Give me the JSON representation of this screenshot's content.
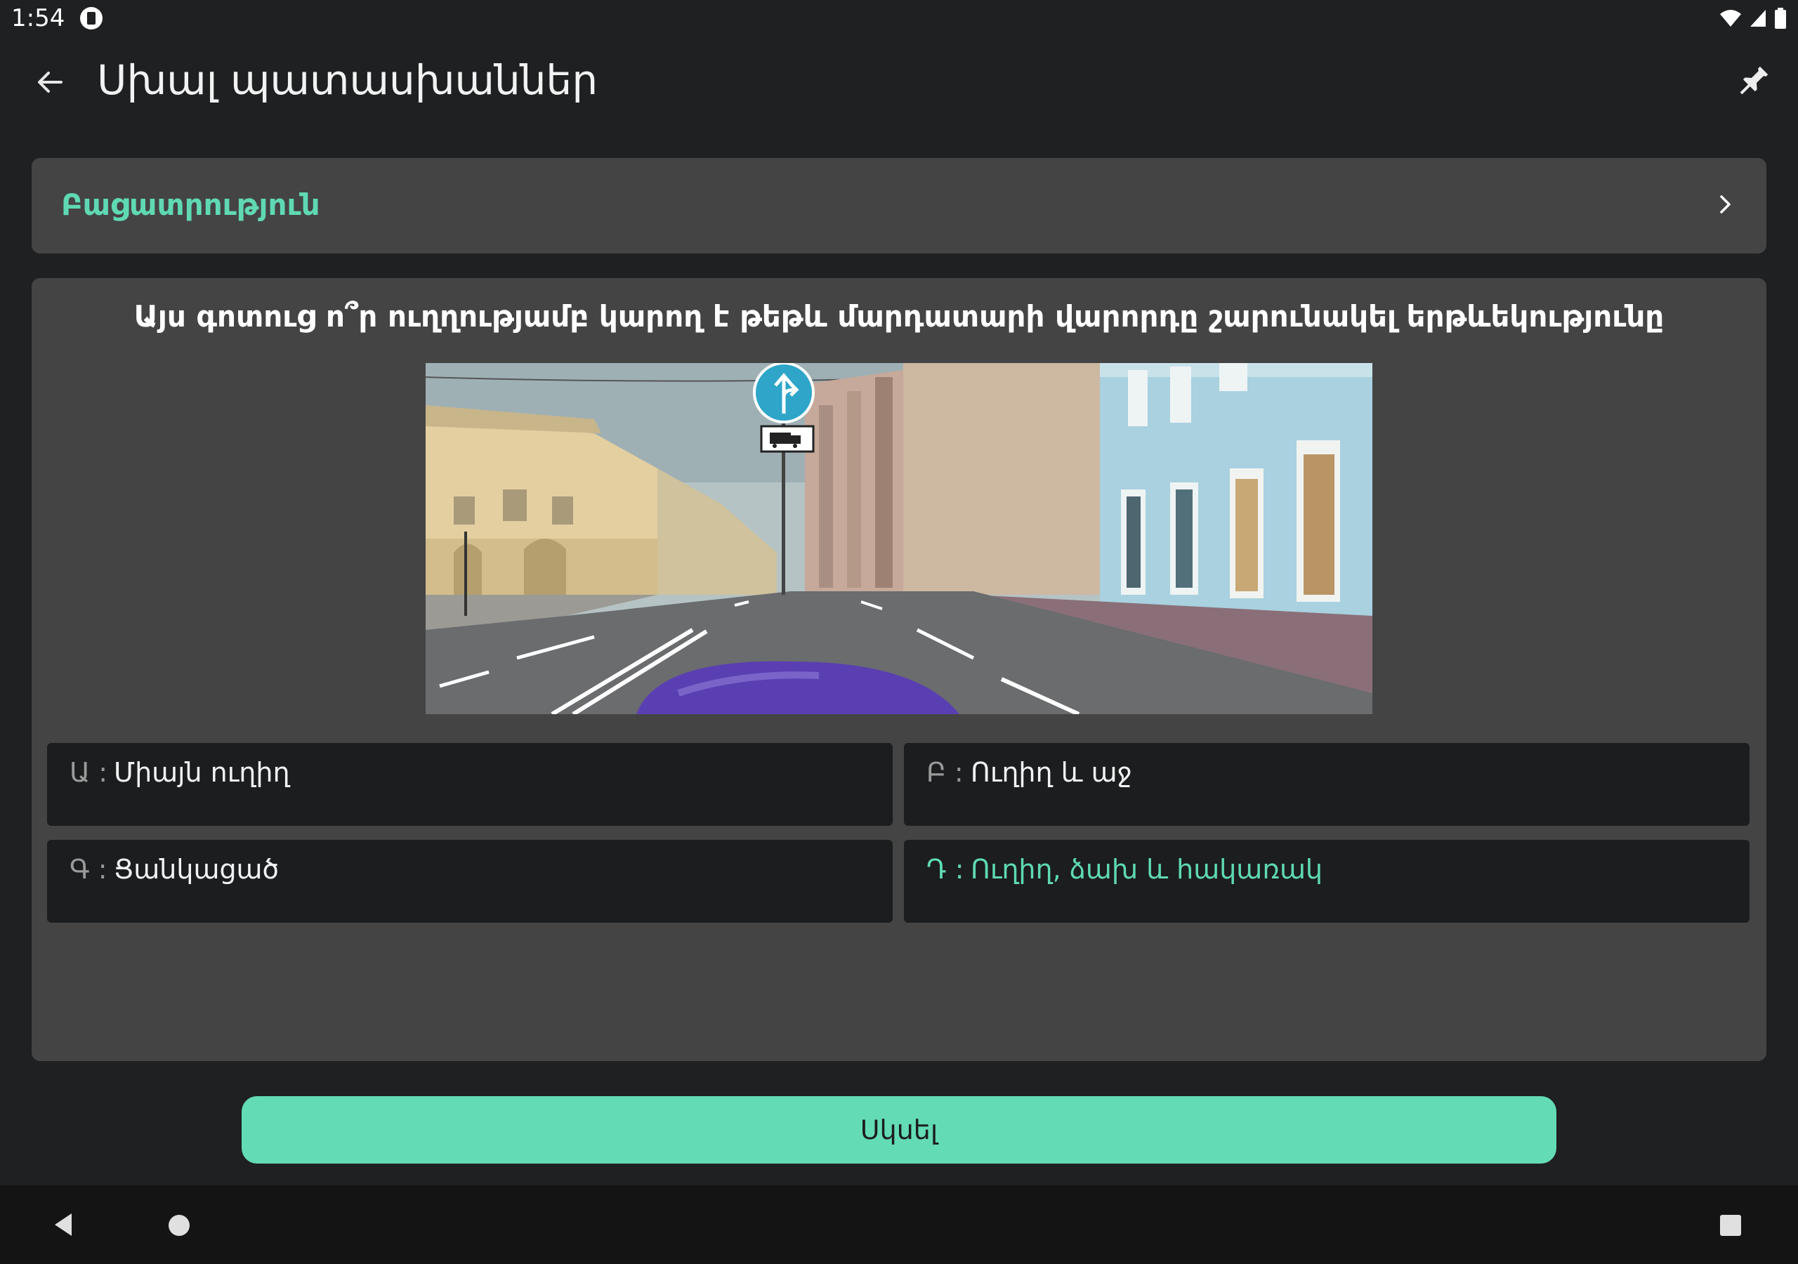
{
  "status_bar": {
    "time": "1:54",
    "icons": [
      "notification-app-icon",
      "wifi-icon",
      "signal-icon",
      "battery-icon"
    ]
  },
  "app_bar": {
    "title": "Սխալ պատասխաններ",
    "back_icon": "arrow-back-icon",
    "pin_icon": "pin-icon"
  },
  "explanation": {
    "label": "Բացատրություն",
    "chevron_icon": "chevron-right-icon"
  },
  "question": {
    "text": "Այս գոտուց ո՞ր ուղղությամբ կարող է թեթև մարդատարի վարորդը շարունակել երթևեկությունը"
  },
  "answers": [
    {
      "letter": "Ա :",
      "text": "Միայն ուղիղ",
      "correct": false
    },
    {
      "letter": "Բ :",
      "text": "Ուղիղ և աջ",
      "correct": false
    },
    {
      "letter": "Գ :",
      "text": "Ցանկացած",
      "correct": false
    },
    {
      "letter": "Դ :",
      "text": "Ուղիղ, ձախ և հակառակ",
      "correct": true
    }
  ],
  "start_button": {
    "label": "Սկսել"
  },
  "colors": {
    "accent": "#5fd9b3",
    "button": "#63dbb5",
    "card": "#444444",
    "background": "#1e2022",
    "answer_bg": "#1b1d1f"
  }
}
